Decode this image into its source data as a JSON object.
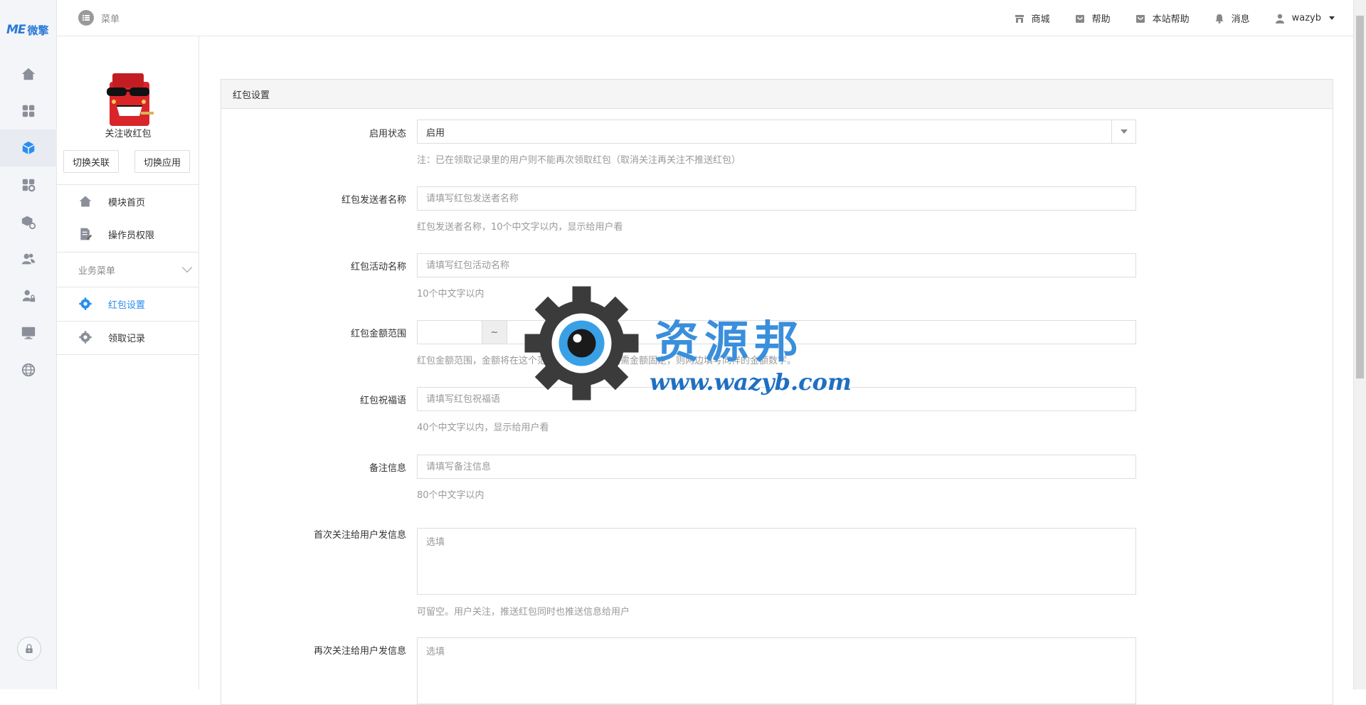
{
  "brand": {
    "mark": "ME",
    "name": "微擎"
  },
  "topbar": {
    "menu_label": "菜单",
    "nav": [
      {
        "label": "商城",
        "icon": "store-icon"
      },
      {
        "label": "帮助",
        "icon": "help-bag-icon"
      },
      {
        "label": "本站帮助",
        "icon": "site-help-bag-icon"
      },
      {
        "label": "消息",
        "icon": "bell-icon"
      }
    ],
    "user": "wazyb"
  },
  "rail": {
    "items": [
      "home-icon",
      "apps-icon",
      "module-cube-icon",
      "addon-apps-icon",
      "cube-settings-icon",
      "users-icon",
      "user-lock-icon",
      "monitor-icon",
      "globe-icon"
    ],
    "active_index": 2,
    "bottom": "lock-icon"
  },
  "module": {
    "title": "关注收红包",
    "switch_link": "切换关联",
    "switch_app": "切换应用",
    "menu": [
      {
        "label": "模块首页",
        "icon": "home-icon"
      },
      {
        "label": "操作员权限",
        "icon": "document-edit-icon"
      }
    ],
    "section_label": "业务菜单",
    "business_menu": [
      {
        "label": "红包设置",
        "icon": "gear-icon",
        "active": true
      },
      {
        "label": "领取记录",
        "icon": "gear-icon",
        "active": false
      }
    ]
  },
  "form": {
    "panel_title": "红包设置",
    "status": {
      "label": "启用状态",
      "value": "启用",
      "help": "注：已在领取记录里的用户则不能再次领取红包（取消关注再关注不推送红包）"
    },
    "sender": {
      "label": "红包发送者名称",
      "placeholder": "请填写红包发送者名称",
      "help": "红包发送者名称，10个中文字以内，显示给用户看"
    },
    "activity": {
      "label": "红包活动名称",
      "placeholder": "请填写红包活动名称",
      "help": "10个中文字以内"
    },
    "amount": {
      "label": "红包金额范围",
      "separator": "~",
      "help": "红包金额范围，金额将在这个范围内随机产生，如需金额固定，则两边填写同样的金额数字。"
    },
    "wish": {
      "label": "红包祝福语",
      "placeholder": "请填写红包祝福语",
      "help": "40个中文字以内，显示给用户看"
    },
    "remark": {
      "label": "备注信息",
      "placeholder": "请填写备注信息",
      "help": "80个中文字以内"
    },
    "first_follow": {
      "label": "首次关注给用户发信息",
      "placeholder": "选填",
      "help": "可留空。用户关注，推送红包同时也推送信息给用户"
    },
    "refollow": {
      "label": "再次关注给用户发信息",
      "placeholder": "选填"
    }
  },
  "watermark": {
    "title": "资源邦",
    "url": "www.wazyb.com"
  }
}
